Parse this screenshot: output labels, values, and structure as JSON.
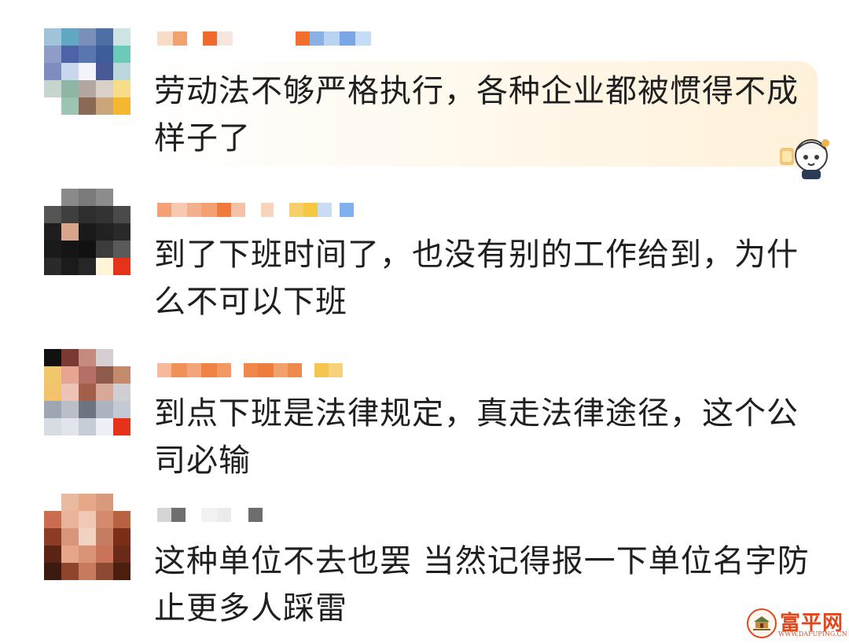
{
  "comments": [
    {
      "text": "劳动法不够严格执行，各种企业都被惯得不成样子了"
    },
    {
      "text": "到了下班时间了，也没有别的工作给到，为什么不可以下班"
    },
    {
      "text": "到点下班是法律规定，真走法律途径，这个公司必输"
    },
    {
      "text": "这种单位不去也罢 当然记得报一下单位名字防止更多人踩雷"
    }
  ],
  "watermark": {
    "name": "富平网",
    "url": "WWW.DAFUPING.CN"
  },
  "colors": {
    "text": "#1f1f1f",
    "bubble_accent": "#fff1d9",
    "watermark": "#e0471f"
  },
  "icons": [
    "pixelated-avatar",
    "chibi-character-sticker",
    "site-logo-icon"
  ]
}
